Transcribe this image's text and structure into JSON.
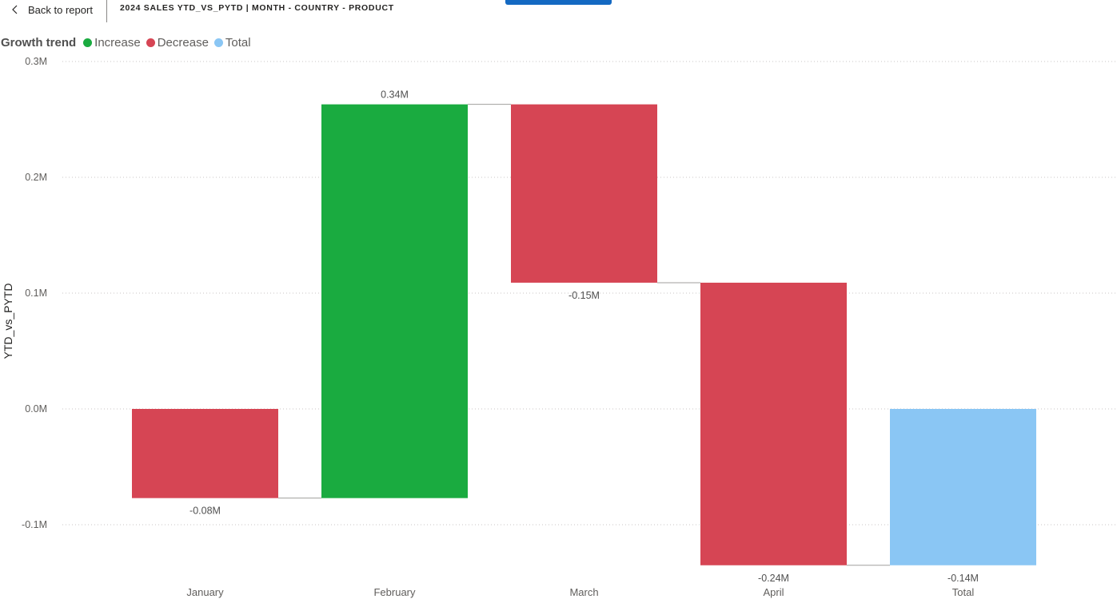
{
  "header": {
    "back_label": "Back to report",
    "report_title": "2024 SALES YTD_VS_PYTD | MONTH - COUNTRY - PRODUCT"
  },
  "legend": {
    "title": "Growth trend",
    "items": [
      {
        "label": "Increase",
        "color": "#1aab40"
      },
      {
        "label": "Decrease",
        "color": "#d64554"
      },
      {
        "label": "Total",
        "color": "#8ac6f4"
      }
    ]
  },
  "chart_data": {
    "type": "waterfall",
    "title": "",
    "xlabel": "",
    "ylabel": "YTD_vs_PYTD",
    "ylim": [
      -0.135,
      0.3
    ],
    "yticks": [
      0.3,
      0.2,
      0.1,
      0.0,
      -0.1
    ],
    "ytick_labels": [
      "0.3M",
      "0.2M",
      "0.1M",
      "0.0M",
      "-0.1M"
    ],
    "categories": [
      "January",
      "February",
      "March",
      "April",
      "Total"
    ],
    "values": [
      -0.077,
      0.34,
      -0.154,
      -0.244,
      -0.135
    ],
    "kinds": [
      "Decrease",
      "Increase",
      "Decrease",
      "Decrease",
      "Total"
    ],
    "data_labels": [
      "-0.08M",
      "0.34M",
      "-0.15M",
      "-0.24M",
      "-0.14M"
    ],
    "grid": true,
    "legend_position": "top-left"
  }
}
